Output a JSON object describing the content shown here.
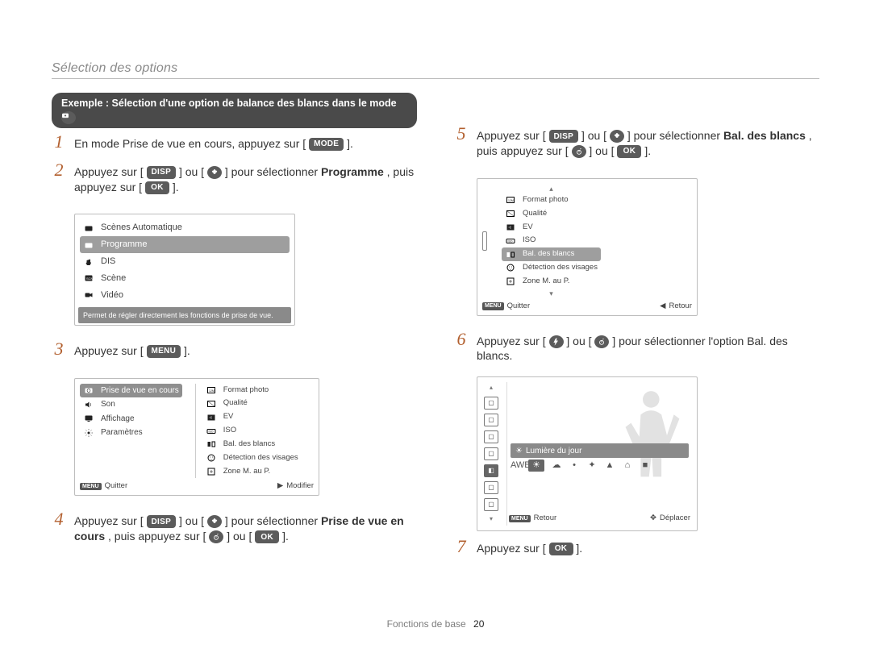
{
  "header": {
    "section": "Sélection des options"
  },
  "example_pill": {
    "text_a": "Exemple : Sélection d'une option de balance des blancs dans le mode ",
    "mode_icon_name": "camera-p-icon"
  },
  "left_steps": {
    "s1": {
      "a": "En mode Prise de vue en cours, appuyez sur [",
      "b": "].",
      "mode_label": "MODE"
    },
    "s2": {
      "a": "Appuyez sur [",
      "b": "] ou [",
      "c": "] pour sélectionner ",
      "d": ", puis appuyez sur [",
      "e": "].",
      "disp_label": "DISP",
      "ok_label": "OK",
      "prog": "Programme"
    },
    "s3": {
      "a": "Appuyez sur [",
      "b": "].",
      "menu_label": "MENU"
    },
    "s4": {
      "a": "Appuyez sur [",
      "b": "] ou [",
      "c": "] pour sélectionner ",
      "d": ", puis appuyez sur [",
      "e": "] ou [",
      "f": "].",
      "disp_label": "DISP",
      "ok_label": "OK",
      "prise": "Prise de vue en cours"
    }
  },
  "right_steps": {
    "s5": {
      "a": "Appuyez sur [",
      "b": "] ou [",
      "c": "] pour sélectionner ",
      "d": ", puis appuyez sur [",
      "e": "] ou [",
      "f": "].",
      "disp_label": "DISP",
      "ok_label": "OK",
      "bal": "Bal. des blancs"
    },
    "s6": {
      "a": "Appuyez sur [",
      "b": "] ou [",
      "c": "] pour sélectionner l'option Bal. des blancs."
    },
    "s7": {
      "a": "Appuyez sur [",
      "b": "].",
      "ok_label": "OK"
    }
  },
  "lcd_mode": {
    "items": [
      {
        "label": "Scènes Automatique",
        "icon": "auto-icon"
      },
      {
        "label": "Programme",
        "icon": "camera-p-icon",
        "selected": true
      },
      {
        "label": "DIS",
        "icon": "dis-hand-icon"
      },
      {
        "label": "Scène",
        "icon": "scene-icon"
      },
      {
        "label": "Vidéo",
        "icon": "video-icon"
      }
    ],
    "hint": "Permet de régler directement les fonctions de prise de vue."
  },
  "lcd_menu": {
    "left_tabs": [
      {
        "label": "Prise de vue en cours",
        "icon": "camera-icon",
        "selected": true
      },
      {
        "label": "Son",
        "icon": "speaker-icon"
      },
      {
        "label": "Affichage",
        "icon": "display-icon"
      },
      {
        "label": "Paramètres",
        "icon": "gear-icon"
      }
    ],
    "right_items": [
      {
        "label": "Format photo",
        "icon": "photo-size-icon"
      },
      {
        "label": "Qualité",
        "icon": "quality-icon"
      },
      {
        "label": "EV",
        "icon": "ev-icon"
      },
      {
        "label": "ISO",
        "icon": "iso-icon"
      },
      {
        "label": "Bal. des blancs",
        "icon": "wb-icon"
      },
      {
        "label": "Détection des visages",
        "icon": "face-icon"
      },
      {
        "label": "Zone M. au P.",
        "icon": "af-area-icon"
      }
    ],
    "footer": {
      "left_mini": "MENU",
      "left": "Quitter",
      "right_glyph": "▶",
      "right": "Modifier"
    }
  },
  "lcd_shootmenu": {
    "items": [
      {
        "label": "Format photo",
        "icon": "photo-size-icon"
      },
      {
        "label": "Qualité",
        "icon": "quality-icon"
      },
      {
        "label": "EV",
        "icon": "ev-icon"
      },
      {
        "label": "ISO",
        "icon": "iso-icon"
      },
      {
        "label": "Bal. des blancs",
        "icon": "wb-icon",
        "selected": true
      },
      {
        "label": "Détection des visages",
        "icon": "face-icon"
      },
      {
        "label": "Zone M. au P.",
        "icon": "af-area-icon"
      }
    ],
    "side_icon": "camera-icon",
    "footer": {
      "left_mini": "MENU",
      "left": "Quitter",
      "right_glyph": "◀",
      "right": "Retour"
    }
  },
  "lcd_wb": {
    "side_icons": [
      "photo-size-icon",
      "quality-icon",
      "ev-icon",
      "iso-icon",
      "wb-icon",
      "face-icon",
      "af-area-icon"
    ],
    "selected_side_index": 4,
    "current_label": "Lumière du jour",
    "options": [
      "AWB",
      "☀",
      "☁",
      "•",
      "✦",
      "▲",
      "⌂",
      "■"
    ],
    "selected_option_index": 1,
    "footer": {
      "left_mini": "MENU",
      "left": "Retour",
      "right_glyph": "✥",
      "right": "Déplacer"
    }
  },
  "footer": {
    "label": "Fonctions de base",
    "page": "20"
  }
}
